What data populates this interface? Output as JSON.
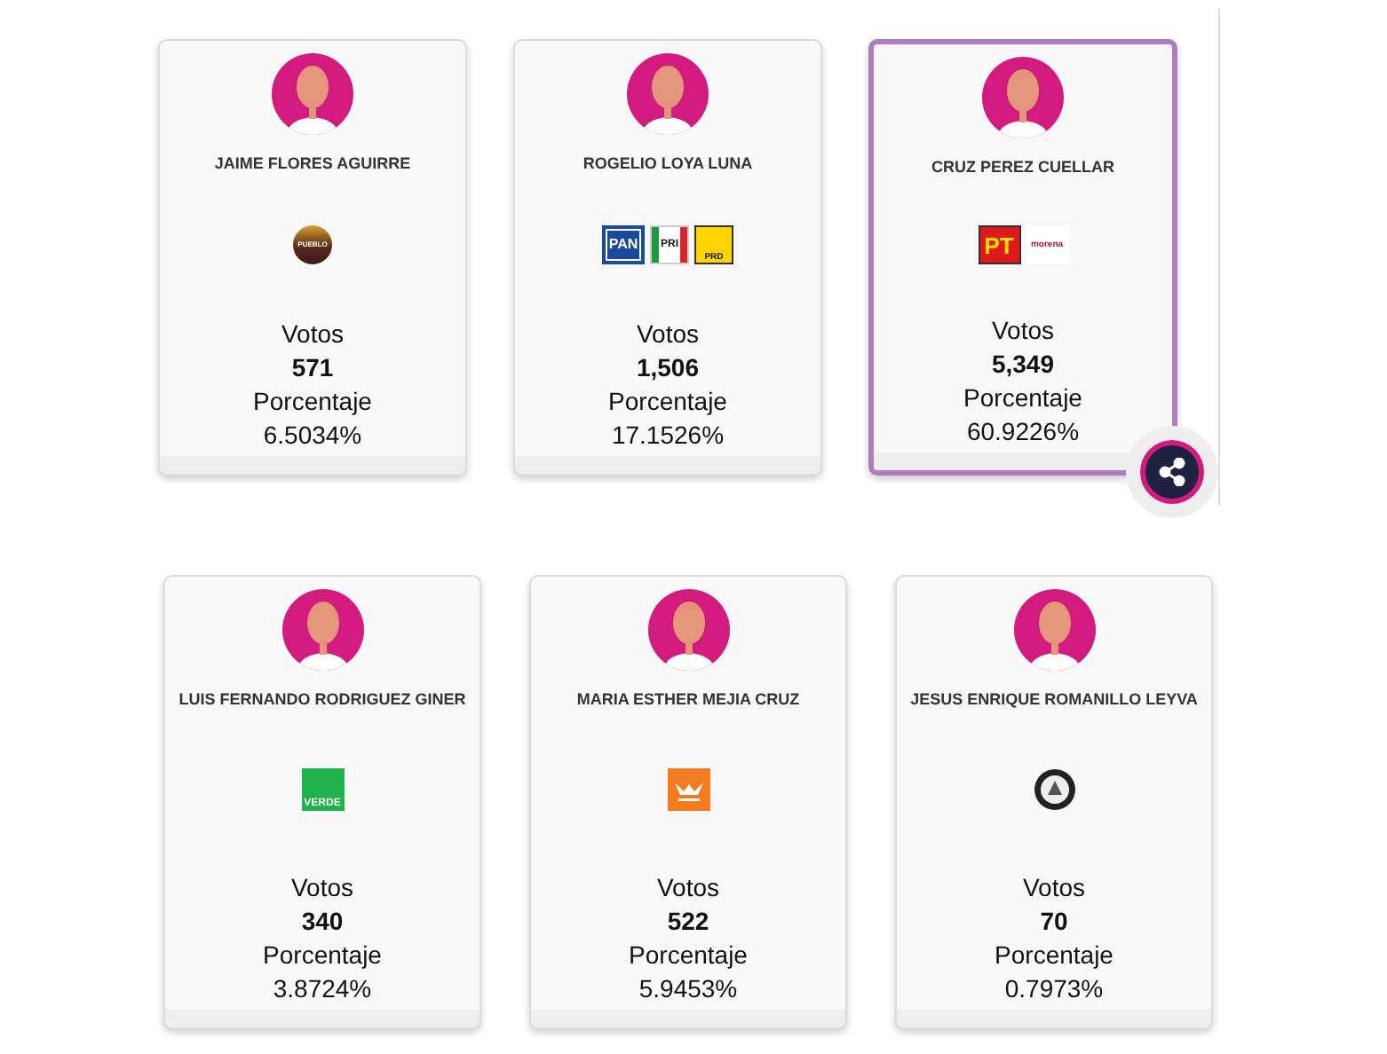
{
  "rows": [
    {
      "cards": [
        {
          "name": "JAIME FLORES AGUIRRE",
          "selected": false,
          "logos": [
            {
              "kind": "pueblo",
              "text": "PUEBLO"
            }
          ],
          "votes_label": "Votos",
          "votes": "571",
          "percent_label": "Porcentaje",
          "percent": "6.5034%"
        },
        {
          "name": "ROGELIO LOYA LUNA",
          "selected": false,
          "logos": [
            {
              "kind": "pan",
              "text": "PAN"
            },
            {
              "kind": "pri",
              "text": "PRI"
            },
            {
              "kind": "prd",
              "text": "PRD"
            }
          ],
          "votes_label": "Votos",
          "votes": "1,506",
          "percent_label": "Porcentaje",
          "percent": "17.1526%"
        },
        {
          "name": "CRUZ PEREZ CUELLAR",
          "selected": true,
          "logos": [
            {
              "kind": "pt",
              "text": "PT"
            },
            {
              "kind": "morena",
              "text": "morena"
            }
          ],
          "votes_label": "Votos",
          "votes": "5,349",
          "percent_label": "Porcentaje",
          "percent": "60.9226%"
        }
      ]
    },
    {
      "cards": [
        {
          "name": "LUIS FERNANDO RODRIGUEZ GINER",
          "selected": false,
          "logos": [
            {
              "kind": "verde",
              "text": "VERDE"
            }
          ],
          "votes_label": "Votos",
          "votes": "340",
          "percent_label": "Porcentaje",
          "percent": "3.8724%"
        },
        {
          "name": "MARIA ESTHER MEJIA CRUZ",
          "selected": false,
          "logos": [
            {
              "kind": "mc"
            }
          ],
          "votes_label": "Votos",
          "votes": "522",
          "percent_label": "Porcentaje",
          "percent": "5.9453%"
        },
        {
          "name": "JESUS ENRIQUE ROMANILLO LEYVA",
          "selected": false,
          "logos": [
            {
              "kind": "seal"
            }
          ],
          "votes_label": "Votos",
          "votes": "70",
          "percent_label": "Porcentaje",
          "percent": "0.7973%"
        }
      ]
    }
  ]
}
